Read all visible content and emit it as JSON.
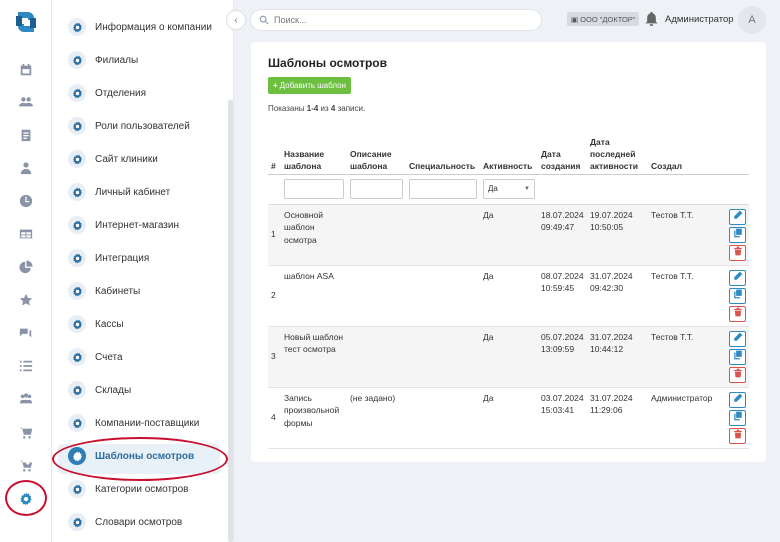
{
  "rail": {
    "icons": [
      "logo-icon",
      "calendar-icon",
      "users-icon",
      "clipboard-icon",
      "doctor-icon",
      "clock-icon",
      "table-icon",
      "pie-chart-icon",
      "star-icon",
      "chat-icon",
      "list-icon",
      "group-icon",
      "cart-icon",
      "cart-add-icon",
      "gear-icon"
    ]
  },
  "sidebar": {
    "items": [
      {
        "label": "Информация о компании"
      },
      {
        "label": "Филиалы"
      },
      {
        "label": "Отделения"
      },
      {
        "label": "Роли пользователей"
      },
      {
        "label": "Сайт клиники"
      },
      {
        "label": "Личный кабинет"
      },
      {
        "label": "Интернет-магазин"
      },
      {
        "label": "Интеграция"
      },
      {
        "label": "Кабинеты"
      },
      {
        "label": "Кассы"
      },
      {
        "label": "Счета"
      },
      {
        "label": "Склады"
      },
      {
        "label": "Компании-поставщики"
      },
      {
        "label": "Шаблоны осмотров"
      },
      {
        "label": "Категории осмотров"
      },
      {
        "label": "Словари осмотров"
      }
    ]
  },
  "topbar": {
    "collapse": "‹",
    "search_placeholder": "Поиск...",
    "org": "ООО \"ДОКТОР\"",
    "user": "Администратор",
    "avatar": "A"
  },
  "main": {
    "title": "Шаблоны осмотров",
    "add_button": "Добавить шаблон",
    "summary_prefix": "Показаны ",
    "summary_range": "1-4",
    "summary_mid": " из ",
    "summary_total": "4",
    "summary_suffix": " записи.",
    "columns": [
      "#",
      "Название шаблона",
      "Описание шаблона",
      "Специальность",
      "Активность",
      "Дата создания",
      "Дата последней активности",
      "Создал"
    ],
    "filter_active": "Да",
    "rows": [
      {
        "idx": "1",
        "name": "Основной шаблон осмотра",
        "desc": "",
        "spec": "",
        "active": "Да",
        "created": "18.07.2024 09:49:47",
        "last": "19.07.2024 10:50:05",
        "author": "Тестов Т.Т."
      },
      {
        "idx": "2",
        "name": "шаблон ASA",
        "desc": "",
        "spec": "",
        "active": "Да",
        "created": "08.07.2024 10:59:45",
        "last": "31.07.2024 09:42:30",
        "author": "Тестов Т.Т."
      },
      {
        "idx": "3",
        "name": "Новый шаблон тест осмотра",
        "desc": "",
        "spec": "",
        "active": "Да",
        "created": "05.07.2024 13:09:59",
        "last": "31.07.2024 10:44:12",
        "author": "Тестов Т.Т."
      },
      {
        "idx": "4",
        "name": "Запись произвольной формы",
        "desc": "(не задано)",
        "spec": "",
        "active": "Да",
        "created": "03.07.2024 15:03:41",
        "last": "31.07.2024 11:29:06",
        "author": "Администратор"
      }
    ]
  },
  "colors": {
    "accent": "#2e8ac4",
    "add": "#6cbf3f",
    "delete": "#d9534f",
    "highlight_circle": "#c8102e"
  }
}
